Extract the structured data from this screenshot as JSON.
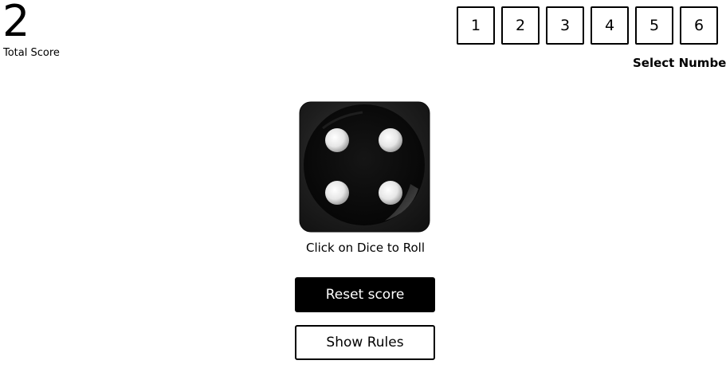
{
  "score": {
    "value": "2",
    "label": "Total Score"
  },
  "number_selector": {
    "options": [
      "1",
      "2",
      "3",
      "4",
      "5",
      "6"
    ],
    "label": "Select Number"
  },
  "dice": {
    "face_value": 4,
    "icon": "dice-face-4-icon",
    "hint": "Click on Dice to Roll"
  },
  "actions": {
    "reset_label": "Reset score",
    "rules_label": "Show Rules"
  },
  "colors": {
    "primary": "#000000",
    "background": "#ffffff",
    "dice_body": "#1a1a1a",
    "dice_pip": "#eeeeee"
  }
}
